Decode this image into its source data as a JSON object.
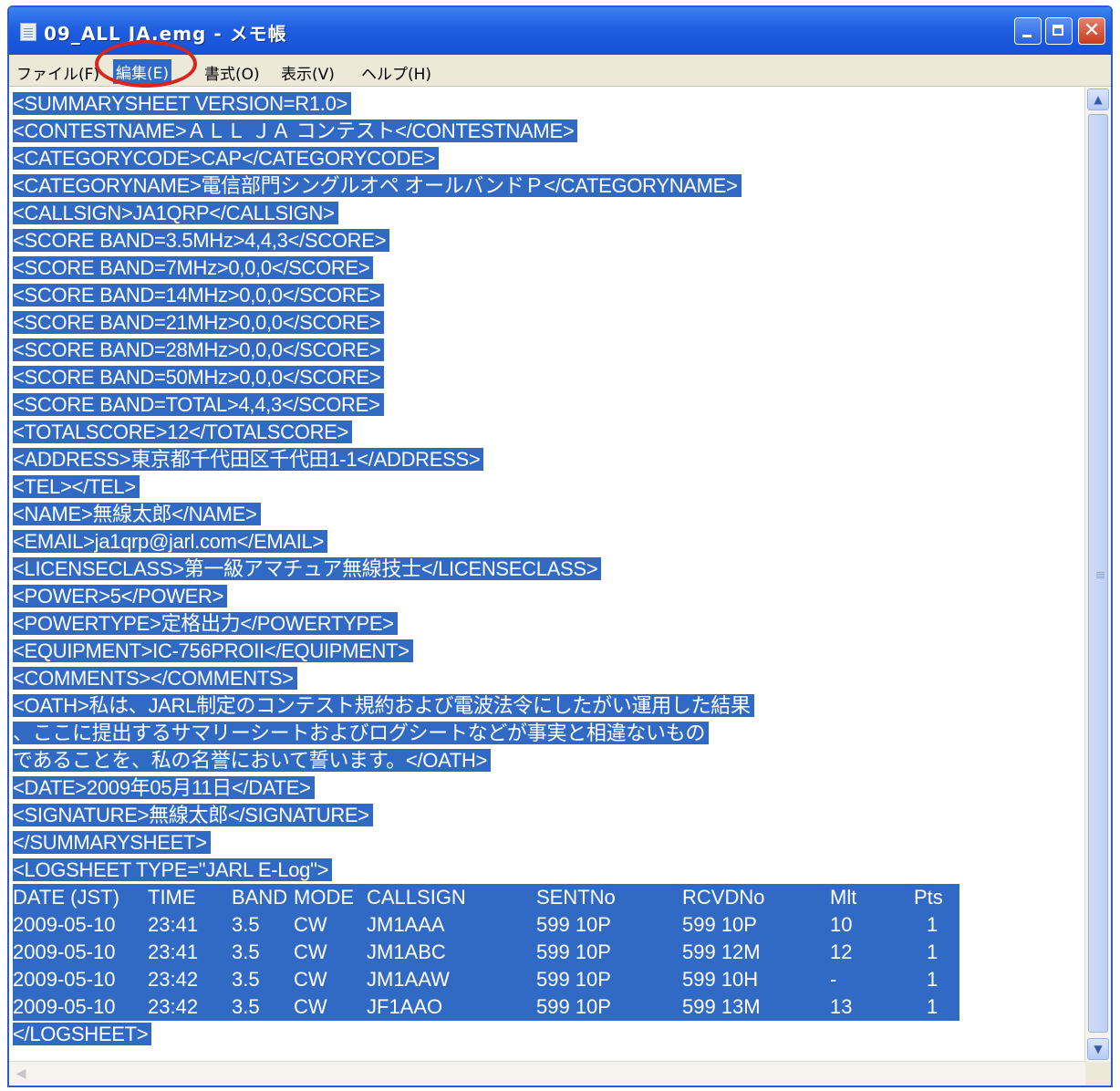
{
  "window": {
    "title": "09_ALL JA.emg - メモ帳",
    "close_glyph": "✕"
  },
  "menu": {
    "file": "ファイル(F)",
    "edit": "編集(E)",
    "format": "書式(O)",
    "view": "表示(V)",
    "help": "ヘルプ(H)"
  },
  "document": {
    "lines": [
      "<SUMMARYSHEET VERSION=R1.0>",
      "<CONTESTNAME>ＡＬＬ ＪＡ コンテスト</CONTESTNAME>",
      "<CATEGORYCODE>CAP</CATEGORYCODE>",
      "<CATEGORYNAME>電信部門シングルオペ オールバンドＰ</CATEGORYNAME>",
      "<CALLSIGN>JA1QRP</CALLSIGN>",
      "<SCORE BAND=3.5MHz>4,4,3</SCORE>",
      "<SCORE BAND=7MHz>0,0,0</SCORE>",
      "<SCORE BAND=14MHz>0,0,0</SCORE>",
      "<SCORE BAND=21MHz>0,0,0</SCORE>",
      "<SCORE BAND=28MHz>0,0,0</SCORE>",
      "<SCORE BAND=50MHz>0,0,0</SCORE>",
      "<SCORE BAND=TOTAL>4,4,3</SCORE>",
      "<TOTALSCORE>12</TOTALSCORE>",
      "<ADDRESS>東京都千代田区千代田1-1</ADDRESS>",
      "<TEL></TEL>",
      "<NAME>無線太郎</NAME>",
      "<EMAIL>ja1qrp@jarl.com</EMAIL>",
      "<LICENSECLASS>第一級アマチュア無線技士</LICENSECLASS>",
      "<POWER>5</POWER>",
      "<POWERTYPE>定格出力</POWERTYPE>",
      "<EQUIPMENT>IC-756PROII</EQUIPMENT>",
      "<COMMENTS></COMMENTS>",
      "<OATH>私は、JARL制定のコンテスト規約および電波法令にしたがい運用した結果",
      "、ここに提出するサマリーシートおよびログシートなどが事実と相違ないもの",
      "であることを、私の名誉において誓います。</OATH>",
      "<DATE>2009年05月11日</DATE>",
      "<SIGNATURE>無線太郎</SIGNATURE>",
      "</SUMMARYSHEET>",
      "<LOGSHEET TYPE=\"JARL E-Log\">"
    ],
    "log_header": {
      "date": "DATE (JST)",
      "time": "TIME",
      "band": "BAND",
      "mode": "MODE",
      "callsign": "CALLSIGN",
      "sent": "SENTNo",
      "rcvd": "RCVDNo",
      "mlt": "Mlt",
      "pts": "Pts"
    },
    "log_rows": [
      {
        "date": "2009-05-10",
        "time": "23:41",
        "band": "3.5",
        "mode": "CW",
        "callsign": "JM1AAA",
        "sent": "599 10P",
        "rcvd": "599 10P",
        "mlt": "10",
        "pts": "1"
      },
      {
        "date": "2009-05-10",
        "time": "23:41",
        "band": "3.5",
        "mode": "CW",
        "callsign": "JM1ABC",
        "sent": "599 10P",
        "rcvd": "599 12M",
        "mlt": "12",
        "pts": "1"
      },
      {
        "date": "2009-05-10",
        "time": "23:42",
        "band": "3.5",
        "mode": "CW",
        "callsign": "JM1AAW",
        "sent": "599 10P",
        "rcvd": "599 10H",
        "mlt": "-",
        "pts": "1"
      },
      {
        "date": "2009-05-10",
        "time": "23:42",
        "band": "3.5",
        "mode": "CW",
        "callsign": "JF1AAO",
        "sent": "599 10P",
        "rcvd": "599 13M",
        "mlt": "13",
        "pts": "1"
      }
    ],
    "closing_line": "</LOGSHEET>"
  },
  "colors": {
    "selection": "#316ac5",
    "titlebar": "#1f5fe0",
    "annotation": "#d9251d"
  },
  "icons": [
    "notepad-icon",
    "minimize-icon",
    "maximize-icon",
    "close-icon",
    "scroll-up-icon",
    "scroll-down-icon",
    "scroll-left-icon"
  ]
}
